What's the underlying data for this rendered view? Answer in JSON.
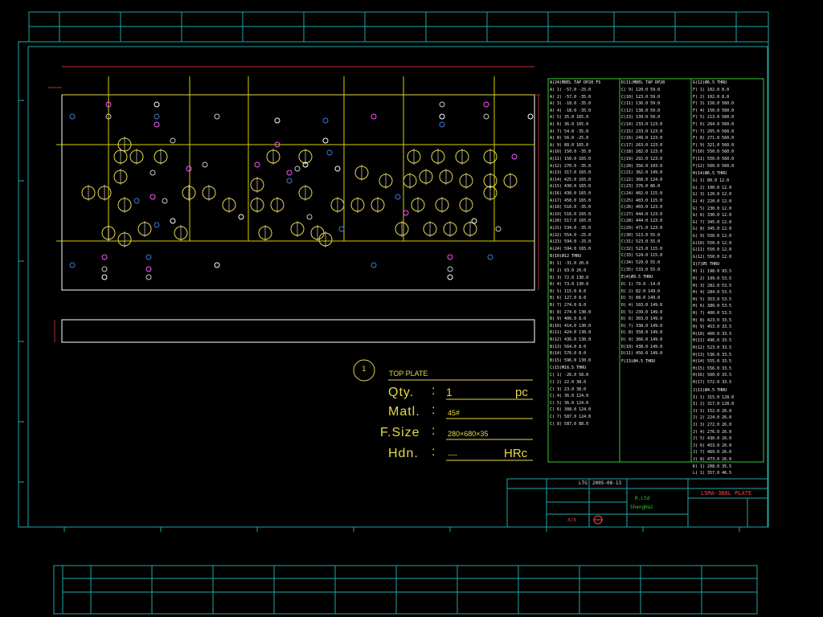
{
  "colors": {
    "background": "#000000",
    "frame": "#1fa7a7",
    "outline": "#ffffff",
    "center_lines": "#d8d000",
    "dims": "#ff4040",
    "table_border": "#2bd12b",
    "note_text": "#e6d84a",
    "hole_colors": [
      "#3a7bd5",
      "#ff55ff",
      "#c8c8c8",
      "#ffffff"
    ]
  },
  "drawing": {
    "part_number": "1",
    "part_name": "TOP PLATE",
    "qty_label": "Qty.",
    "qty_value": "1",
    "qty_unit": "pc",
    "matl_label": "Matl.",
    "matl_value": "45#",
    "size_label": "F.Size",
    "size_value": "280×680×35",
    "hdn_label": "Hdn.",
    "hdn_value": "----",
    "hdn_unit": "HRc",
    "colon": ":"
  },
  "title_block": {
    "company": "ShengHai",
    "company_sub": "R.Ltd",
    "date": "2005-08-13",
    "ltg": "LTG",
    "title": "L5MA-3B8L PLATE",
    "scale": "X/X"
  },
  "hole_table": {
    "sections": [
      "A(24)M8EL TAP DP28 FS",
      "B(10)Ø12 THRU",
      "C(15)M16.5 THRU",
      "D(11)M8EL TAP DP28",
      "E(4)Ø9.5 THRU",
      "F(13)Ø4.5 THRU",
      "G(12)Ø6.5 THRU",
      "H(14)Ø6.5 THRU",
      "I(7)Ø5 THRU",
      "J(11)Ø4.5 THRU",
      "K(4)M12 TAP DP28 FS",
      "L(4)M12 TAP DP28"
    ],
    "rows_col1": [
      "A( 1)   -57.0   -25.0",
      "A( 2)   -57.0   -35.0",
      "A( 3)   -18.0   -35.0",
      "A( 4)   -18.0   -35.0",
      "A( 5)    35.0   165.0",
      "A( 6)    36.0   165.0",
      "A( 7)    54.0   -35.0",
      "A( 8)    56.0   -25.0",
      "A( 9)    80.0   165.0",
      "A(10)   150.0   -35.0",
      "A(11)   150.0   165.0",
      "A(12)   270.0   -35.0",
      "A(13)   317.0   165.0",
      "A(14)   425.0   165.0",
      "A(15)   430.0   165.0",
      "A(16)   430.0   165.0",
      "A(17)   450.0   165.0",
      "A(18)   516.0   -35.0",
      "A(19)   516.0   165.0",
      "A(20)   517.0   165.0",
      "A(21)   534.0   -35.0",
      "A(22)   554.0   -25.0",
      "A(23)   594.0   -25.0",
      "A(24)   594.0   165.0"
    ],
    "rows_col1b": [
      "B( 1)   -31.0    20.0",
      "B( 2)    93.0    20.0",
      "B( 3)    72.0   130.0",
      "B( 4)    73.0   130.0",
      "B( 5)   115.0     8.0",
      "B( 6)   127.0     8.0",
      "B( 7)   274.0     8.0",
      "B( 8)   274.0   130.0",
      "B( 9)   406.0     8.0",
      "B(10)   414.0   130.0",
      "B(11)   424.0   130.0",
      "B(12)   436.0   130.0",
      "B(13)   564.0     8.0",
      "B(14)   576.0     8.0",
      "B(15)   596.0   130.0"
    ],
    "rows_col1c": [
      "C( 1)   -26.0    58.0",
      "C( 2)    22.0    38.0",
      "C( 3)    23.0    38.0",
      "C( 4)    36.0   124.0",
      "C( 5)    36.0   124.0",
      "C( 6)   308.0   124.0",
      "C( 7)   587.0   124.0",
      "C( 8)   587.0    88.0"
    ],
    "rows_col2": [
      "C( 9)   120.0    59.0",
      "C(10)   123.0    59.0",
      "C(11)   136.0    59.0",
      "C(12)   138.0    59.0",
      "C(13)   139.0    59.0",
      "C(14)   233.0   123.0",
      "C(15)   233.0   123.0",
      "C(16)   249.0   123.0",
      "C(17)   263.0   123.0",
      "C(18)   282.0   123.0",
      "C(19)   292.0   123.0",
      "C(20)   356.0   103.0",
      "C(21)   362.0   149.0",
      "C(22)   368.0   124.0",
      "C(23)   376.0    86.0",
      "C(24)   402.0   115.0",
      "C(25)   403.0   115.0",
      "C(26)   403.0   123.0",
      "C(27)   444.0   123.0",
      "C(28)   444.0   123.0",
      "C(29)   471.0   123.0",
      "C(30)   513.0    55.0",
      "C(31)   523.0    55.0",
      "C(32)   523.0   115.0",
      "C(33)   524.0   115.0",
      "C(34)   529.0    55.0",
      "C(35)   533.0    55.0"
    ],
    "rows_col2b": [
      "D( 1)    79.0   -14.0",
      "D( 2)    82.0   149.0",
      "D( 3)    88.0   149.0",
      "D( 4)   103.0   149.0",
      "D( 5)   239.0   149.0",
      "D( 6)   303.0   149.0",
      "D( 7)   338.0   149.0",
      "D( 8)   358.0   149.0",
      "D( 9)   366.0   149.0",
      "D(10)   438.0   149.0",
      "D(11)   456.0   149.0"
    ],
    "rows_col2c": [
      "E( 1)    -5.6    15.5",
      "E( 2)   167.5    15.5",
      "E( 3)    34.0    15.5",
      "E( 4)    40.0    15.5",
      "E( 5)    47.0    15.5",
      "E( 6)    56.0    15.5",
      "E( 7)    46.0    15.5",
      "E( 8)    46.0    15.5",
      "E( 9)    61.0    61.0",
      "E(10)    66.0    61.0",
      "E(11)    97.0    61.0",
      "E(12)   100.0    61.0",
      "E(13)   107.0    56.0",
      "E(14)   163.0    56.0",
      "E(15)   183.0    56.0",
      "E(16)   186.0    56.0",
      "E(17)   187.0    56.0",
      "E(18)   198.0    56.0",
      "E(19)   199.0    56.0",
      "E(20)   202.0    56.0"
    ],
    "rows_col3": [
      "F( 1)   102.0     8.0",
      "F( 2)   102.0     8.0",
      "F( 3)   150.0   560.0",
      "F( 4)   150.0   560.0",
      "F( 5)   213.0   560.0",
      "F( 6)   264.0   560.0",
      "F( 7)   265.0   560.0",
      "F( 8)   271.0   560.0",
      "F( 9)   321.0   560.0",
      "F(10)   550.0   560.0",
      "F(11)   550.0   560.0",
      "F(12)   560.0   560.0"
    ],
    "rows_col3b": [
      "G( 1)    80.0    12.0",
      "G( 2)   100.0    12.0",
      "G( 3)   120.0    12.0",
      "G( 4)   220.0    12.0",
      "G( 5)   230.0    12.0",
      "G( 6)   330.0    12.0",
      "G( 7)   345.0    12.0",
      "G( 8)   345.0    12.0",
      "G( 9)   550.0    12.0",
      "G(10)   550.0    12.0",
      "G(11)   550.0    12.0",
      "G(12)   550.0    12.0"
    ],
    "rows_col3c": [
      "H( 1)   198.0    93.5",
      "H( 2)   199.0    53.5",
      "H( 3)   282.0    53.5",
      "H( 4)   284.0    53.5",
      "H( 5)   353.0    53.5",
      "H( 6)   380.0    53.5",
      "H( 7)   400.0    53.5",
      "H( 8)   423.0    33.5",
      "H( 9)   453.0    33.5",
      "H(10)   460.0    33.5",
      "H(11)   496.0    33.5",
      "H(12)   523.0    33.5",
      "H(13)   536.0    33.5",
      "H(14)   555.0    33.5",
      "H(15)   556.0    33.5",
      "H(16)   560.0    33.5",
      "H(17)   572.0    33.5"
    ],
    "rows_col3d": [
      "I( 1)   315.0   128.0",
      "I( 2)   317.0   128.0",
      "J( 1)   152.0    26.0",
      "J( 2)   224.0    26.0",
      "J( 3)   272.0    26.0",
      "J( 4)   276.0    26.0",
      "J( 5)   430.0    26.0",
      "J( 6)   453.0    26.0",
      "J( 7)   469.0    26.0",
      "J( 8)   473.0    26.0",
      "K( 1)   208.0    35.5",
      "L( 1)   357.0    46.5"
    ]
  }
}
